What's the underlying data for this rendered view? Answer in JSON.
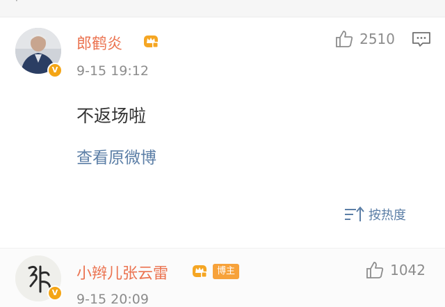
{
  "comments": [
    {
      "name": "郎鹤炎",
      "time": "9-15 19:12",
      "likes": "2510",
      "content": "不返场啦",
      "view_original": "查看原微博",
      "verified_badge": "V"
    },
    {
      "name": "小辫儿张云雷",
      "tag": "博主",
      "time": "9-15 20:09",
      "likes": "1042",
      "verified_badge": "V"
    }
  ],
  "sort_label": "按热度",
  "icons": {
    "like": "thumbs-up-icon",
    "reply": "comment-bubble-icon",
    "crown": "crown-badge-icon",
    "sort": "sort-icon"
  },
  "colors": {
    "name": "#eb7350",
    "link": "#5b7ea6",
    "meta": "#8c8c8c",
    "verified": "#f4a515",
    "owner_tag": "#f7a23a"
  }
}
